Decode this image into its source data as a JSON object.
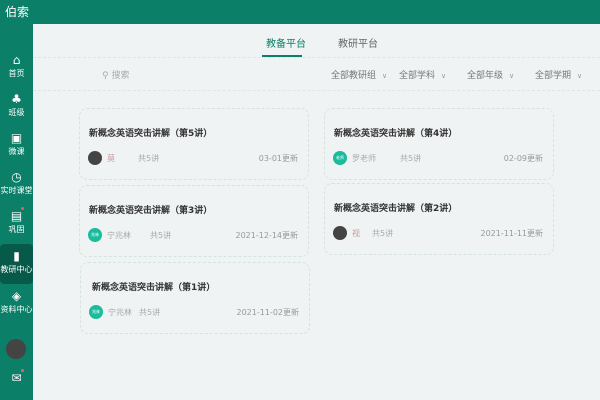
{
  "app": {
    "title": "伯索"
  },
  "sidebar": {
    "items": [
      {
        "label": "首页",
        "icon": "home-icon",
        "glyph": "⌂"
      },
      {
        "label": "班级",
        "icon": "users-icon",
        "glyph": "♣"
      },
      {
        "label": "微课",
        "icon": "video-icon",
        "glyph": "▣"
      },
      {
        "label": "实时课堂",
        "icon": "clock-icon",
        "glyph": "◷"
      },
      {
        "label": "巩固",
        "icon": "book-icon",
        "glyph": "▤"
      },
      {
        "label": "教研中心",
        "icon": "document-icon",
        "glyph": "▮"
      },
      {
        "label": "资料中心",
        "icon": "layers-icon",
        "glyph": "◈"
      }
    ],
    "mail_icon": "mail-icon"
  },
  "tabs": [
    {
      "label": "教备平台",
      "active": true
    },
    {
      "label": "教研平台",
      "active": false
    }
  ],
  "search": {
    "placeholder": "搜索"
  },
  "filters": [
    "全部教研组",
    "全部学科",
    "全部年级",
    "全部学期"
  ],
  "colors": {
    "brand": "#0b7f68",
    "avatar_teal": "#1abc9c"
  },
  "cards": [
    {
      "title": "新概念英语突击讲解（第5讲）",
      "author": "莫",
      "avatar": "",
      "count": "共5讲",
      "date": "03-01更新"
    },
    {
      "title": "新概念英语突击讲解（第4讲）",
      "author": "罗老师",
      "avatar": "老师",
      "count": "共5讲",
      "date": "02-09更新"
    },
    {
      "title": "新概念英语突击讲解（第3讲）",
      "author": "宁兆林",
      "avatar": "兆林",
      "count": "共5讲",
      "date": "2021-12-14更新"
    },
    {
      "title": "新概念英语突击讲解（第2讲）",
      "author": "视",
      "avatar": "",
      "count": "共5讲",
      "date": "2021-11-11更新"
    },
    {
      "title": "新概念英语突击讲解（第1讲）",
      "author": "宁兆林",
      "avatar": "兆林",
      "count": "共5讲",
      "date": "2021-11-02更新"
    }
  ]
}
